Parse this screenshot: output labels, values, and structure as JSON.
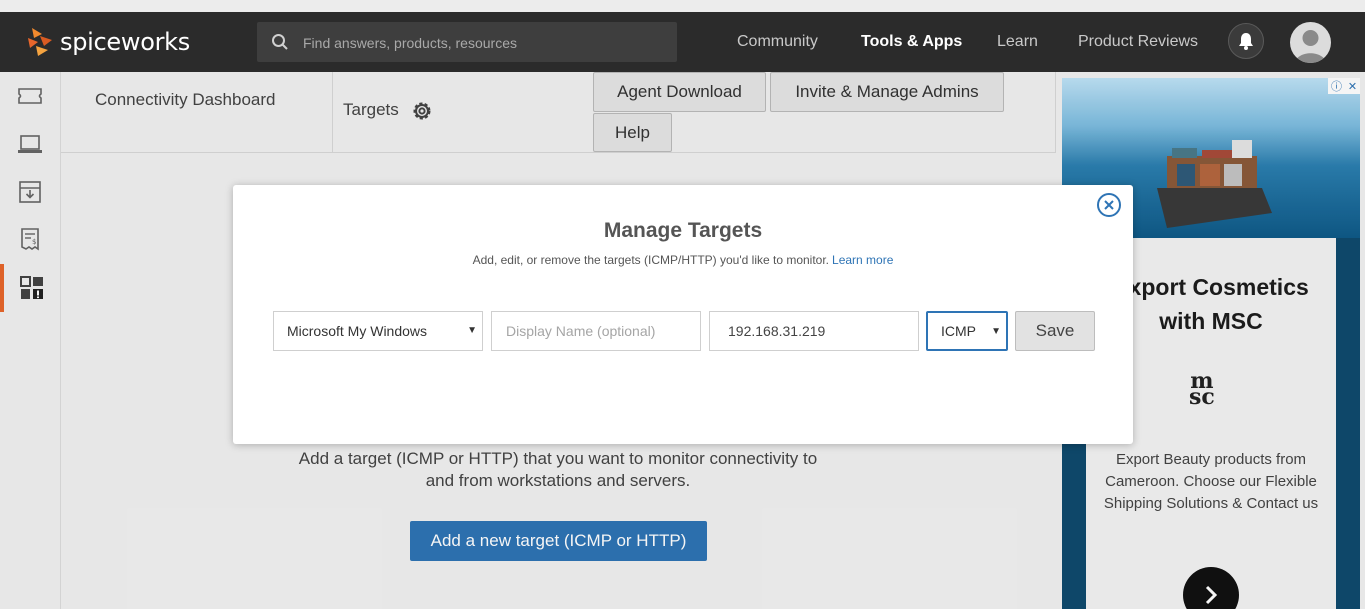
{
  "nav": {
    "brand": "spiceworks",
    "search_placeholder": "Find answers, products, resources",
    "links": [
      "Community",
      "Tools & Apps",
      "Learn",
      "Product Reviews"
    ]
  },
  "sidebar": {
    "icons": [
      "ticket-icon",
      "laptop-icon",
      "download-icon",
      "invoice-icon",
      "dashboard-icon"
    ]
  },
  "tabs": {
    "dashboard": "Connectivity Dashboard",
    "targets": "Targets"
  },
  "toolbar": {
    "agent_download": "Agent Download",
    "invite_admins": "Invite & Manage Admins",
    "help": "Help"
  },
  "content": {
    "line1": "Add a target (ICMP or HTTP) that you want to monitor connectivity to",
    "line2": "and from workstations and servers.",
    "add_button": "Add a new target (ICMP or HTTP)"
  },
  "modal": {
    "title": "Manage Targets",
    "subtitle": "Add, edit, or remove the targets (ICMP/HTTP) you'd like to monitor.",
    "learn_more": "Learn more",
    "target_select": "Microsoft My Windows",
    "display_name_placeholder": "Display Name (optional)",
    "address_value": "192.168.31.219",
    "protocol": "ICMP",
    "save": "Save"
  },
  "ad": {
    "title_line1": "Export Cosmetics",
    "title_line2": "with MSC",
    "logo_top": "m",
    "logo_bottom": "sc",
    "body": "Export Beauty products from Cameroon. Choose our Flexible Shipping Solutions & Contact us"
  },
  "colors": {
    "navbar": "#2b2b2b",
    "accent_blue": "#2e74b5",
    "sidebar_active": "#e8662b"
  }
}
